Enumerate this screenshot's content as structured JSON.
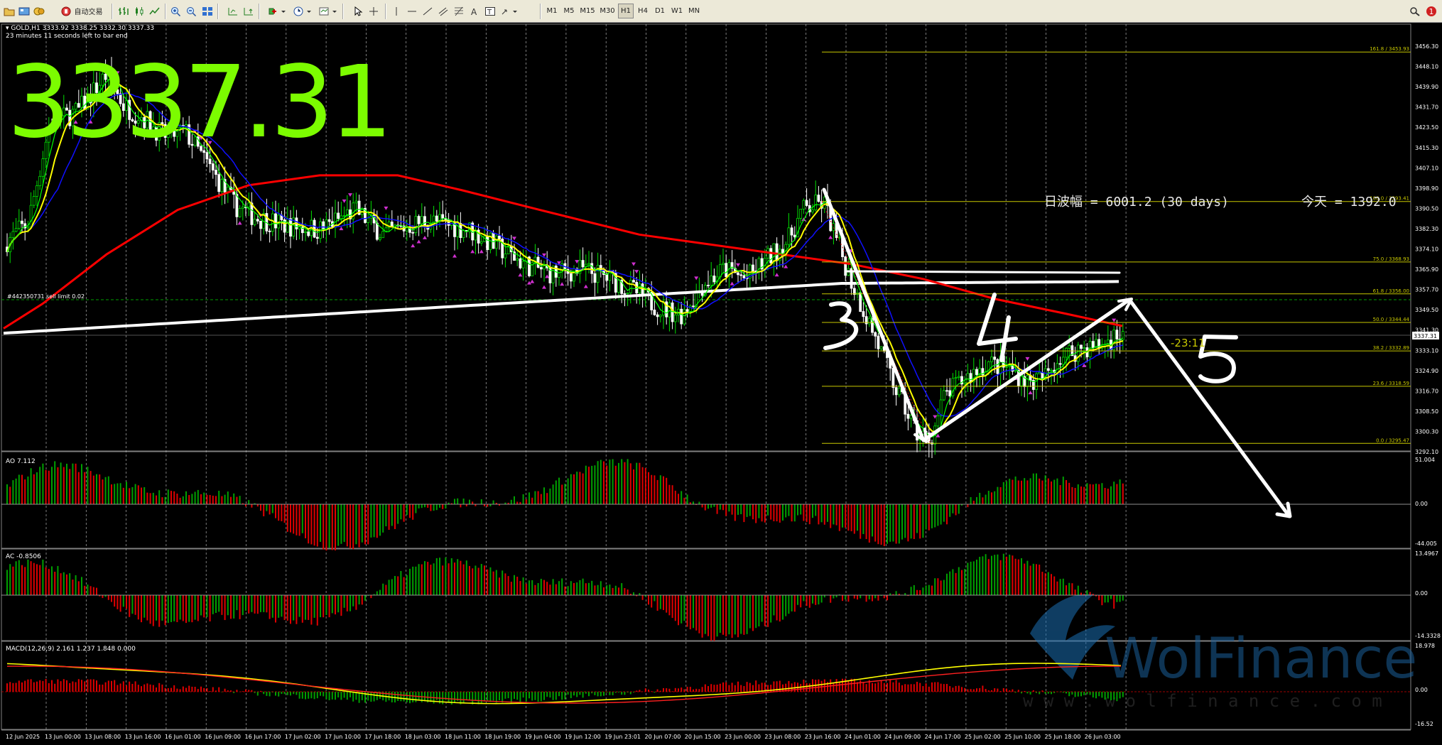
{
  "toolbar": {
    "auto_trading_label": "自动交易",
    "timeframes": [
      "M1",
      "M5",
      "M15",
      "M30",
      "H1",
      "H4",
      "D1",
      "W1",
      "MN"
    ],
    "notification_badge": "1"
  },
  "chart": {
    "symbol_header": "GOLD,H1  3333.92 3338.25 3332.30 3337.33",
    "countdown": "23 minutes 11 seconds left to bar end",
    "big_price": "3337.31",
    "range_info": "日波幅 = 6001.2  (30 days)",
    "today_info": "今天 = 1392.0",
    "order_label": "#442350731 sell limit 0.02",
    "timer_label": "-23:11",
    "current_price_box": "3337.31",
    "wave_labels": [
      "3",
      "4",
      "5"
    ],
    "watermark_brand": "WolFinance",
    "watermark_url": "w w w . w o l f i n a n c e . c o m",
    "price_axis": [
      "3456.30",
      "3448.10",
      "3439.90",
      "3431.70",
      "3423.50",
      "3415.30",
      "3407.10",
      "3398.90",
      "3390.50",
      "3382.30",
      "3374.10",
      "3365.90",
      "3357.70",
      "3349.50",
      "3341.30",
      "3333.10",
      "3324.90",
      "3316.70",
      "3308.50",
      "3300.30",
      "3292.10"
    ],
    "fib_levels": [
      {
        "label": "161.8 / 3453.93",
        "price": 3453.93
      },
      {
        "label": "100.0 / 3393.41",
        "price": 3393.41
      },
      {
        "label": "75.0 / 3368.93",
        "price": 3368.93
      },
      {
        "label": "61.8 / 3356.00",
        "price": 3356.0
      },
      {
        "label": "50.0 / 3344.44",
        "price": 3344.44
      },
      {
        "label": "38.2 / 3332.89",
        "price": 3332.89
      },
      {
        "label": "23.6 / 3318.59",
        "price": 3318.59
      },
      {
        "label": "0.0 / 3295.47",
        "price": 3295.47
      }
    ],
    "time_axis": [
      "12 Jun 2025",
      "13 Jun 00:00",
      "13 Jun 08:00",
      "13 Jun 16:00",
      "16 Jun 01:00",
      "16 Jun 09:00",
      "16 Jun 17:00",
      "17 Jun 02:00",
      "17 Jun 10:00",
      "17 Jun 18:00",
      "18 Jun 03:00",
      "18 Jun 11:00",
      "18 Jun 19:00",
      "19 Jun 04:00",
      "19 Jun 12:00",
      "19 Jun 23:01",
      "20 Jun 07:00",
      "20 Jun 15:00",
      "23 Jun 00:00",
      "23 Jun 08:00",
      "23 Jun 16:00",
      "24 Jun 01:00",
      "24 Jun 09:00",
      "24 Jun 17:00",
      "25 Jun 02:00",
      "25 Jun 10:00",
      "25 Jun 18:00",
      "26 Jun 03:00"
    ],
    "colors": {
      "bull": "#00e000",
      "bear": "#ffffff",
      "ma_red": "#ff0000",
      "ma_white": "#ffffff",
      "ma_blue": "#1010ff",
      "ma_yellow": "#ffff00",
      "ma_green": "#00ff00",
      "big_price": "#7cfc00",
      "fib": "#c8c800",
      "ao_up": "#00a000",
      "ao_down": "#e00000"
    }
  },
  "indicators": {
    "ao": {
      "label": "AO 7.112",
      "axis": [
        "51.004",
        "0.00",
        "-44.005"
      ]
    },
    "ac": {
      "label": "AC -0.8506",
      "axis": [
        "13.4967",
        "0.00",
        "-14.3328"
      ]
    },
    "macd": {
      "label": "MACD(12,26,9) 2.161 1.237 1.848 0.000",
      "axis": [
        "18.978",
        "0.00",
        "-16.52"
      ]
    }
  }
}
